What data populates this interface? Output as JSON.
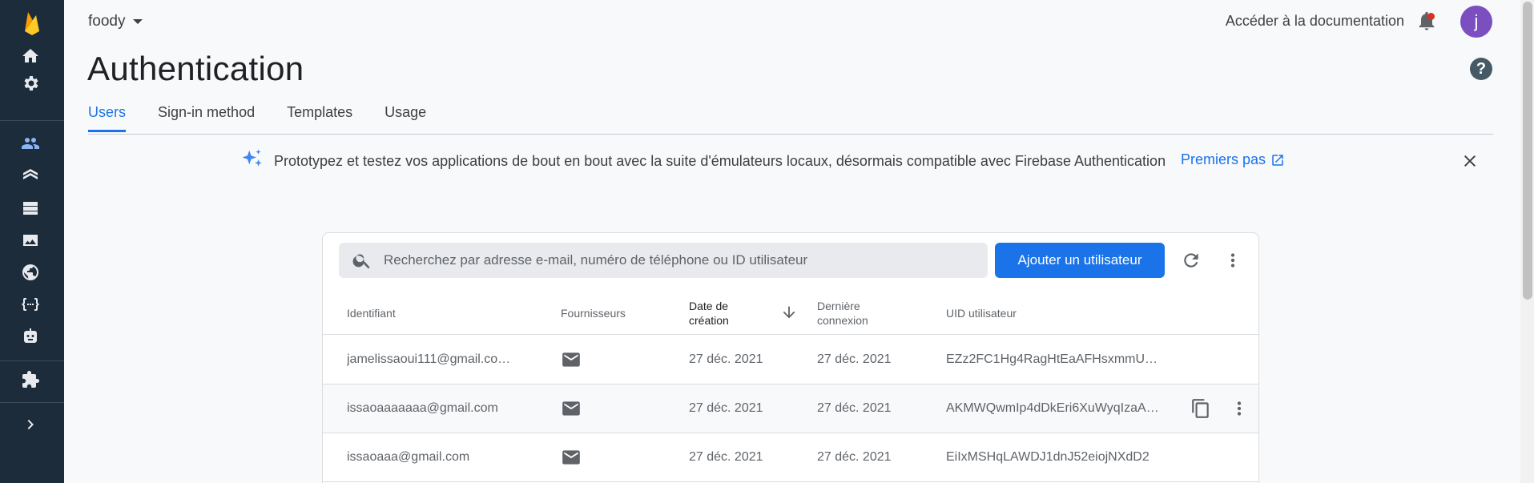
{
  "project": {
    "name": "foody"
  },
  "header": {
    "docs_link": "Accéder à la documentation",
    "avatar_initial": "j"
  },
  "page": {
    "title": "Authentication"
  },
  "tabs": [
    {
      "label": "Users",
      "active": true
    },
    {
      "label": "Sign-in method",
      "active": false
    },
    {
      "label": "Templates",
      "active": false
    },
    {
      "label": "Usage",
      "active": false
    }
  ],
  "banner": {
    "text": "Prototypez et testez vos applications de bout en bout avec la suite d'émulateurs locaux, désormais compatible avec Firebase Authentication",
    "link": "Premiers pas"
  },
  "toolbar": {
    "search_placeholder": "Recherchez par adresse e-mail, numéro de téléphone ou ID utilisateur",
    "add_user": "Ajouter un utilisateur"
  },
  "table": {
    "columns": {
      "identifier": "Identifiant",
      "providers": "Fournisseurs",
      "created_line1": "Date de",
      "created_line2": "création",
      "last_login_line1": "Dernière",
      "last_login_line2": "connexion",
      "uid": "UID utilisateur"
    },
    "rows": [
      {
        "identifier": "jamelissaoui111@gmail.co…",
        "provider_icon": "mail-icon",
        "created": "27 déc. 2021",
        "last_login": "27 déc. 2021",
        "uid": "EZz2FC1Hg4RagHtEaAFHsxmmU…"
      },
      {
        "identifier": "issaoaaaaaaa@gmail.com",
        "provider_icon": "mail-icon",
        "created": "27 déc. 2021",
        "last_login": "27 déc. 2021",
        "uid": "AKMWQwmIp4dDkEri6XuWyqIzaA…"
      },
      {
        "identifier": "issaoaaa@gmail.com",
        "provider_icon": "mail-icon",
        "created": "27 déc. 2021",
        "last_login": "27 déc. 2021",
        "uid": "EiIxMSHqLAWDJ1dnJ52eiojNXdD2"
      }
    ]
  },
  "sidebar": {
    "icons": [
      "firebase-logo-icon",
      "home-icon",
      "settings-icon",
      "authentication-icon",
      "firestore-icon",
      "realtime-database-icon",
      "storage-icon",
      "hosting-icon",
      "functions-icon",
      "machine-learning-icon",
      "extensions-icon",
      "expand-icon"
    ]
  },
  "colors": {
    "sidebar": "#1c2c3b",
    "accent": "#1a73e8",
    "avatar": "#7b4fbf"
  }
}
